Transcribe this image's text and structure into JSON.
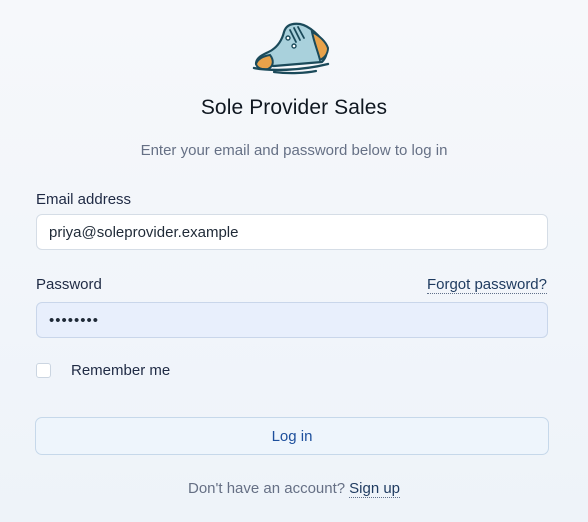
{
  "app": {
    "title": "Sole Provider Sales",
    "subtitle": "Enter your email and password below to log in",
    "logo_icon": "sneaker-icon"
  },
  "form": {
    "email": {
      "label": "Email address",
      "value": "priya@soleprovider.example"
    },
    "password": {
      "label": "Password",
      "value": "••••••••",
      "forgot_link": "Forgot password?"
    },
    "remember": {
      "label": "Remember me",
      "checked": false
    },
    "login_button": "Log in"
  },
  "footer": {
    "prompt": "Don't have an account?",
    "signup_link": "Sign up"
  },
  "colors": {
    "accent": "#1d4f9c",
    "button_bg": "#eef5fc",
    "password_bg": "#e8effc"
  }
}
